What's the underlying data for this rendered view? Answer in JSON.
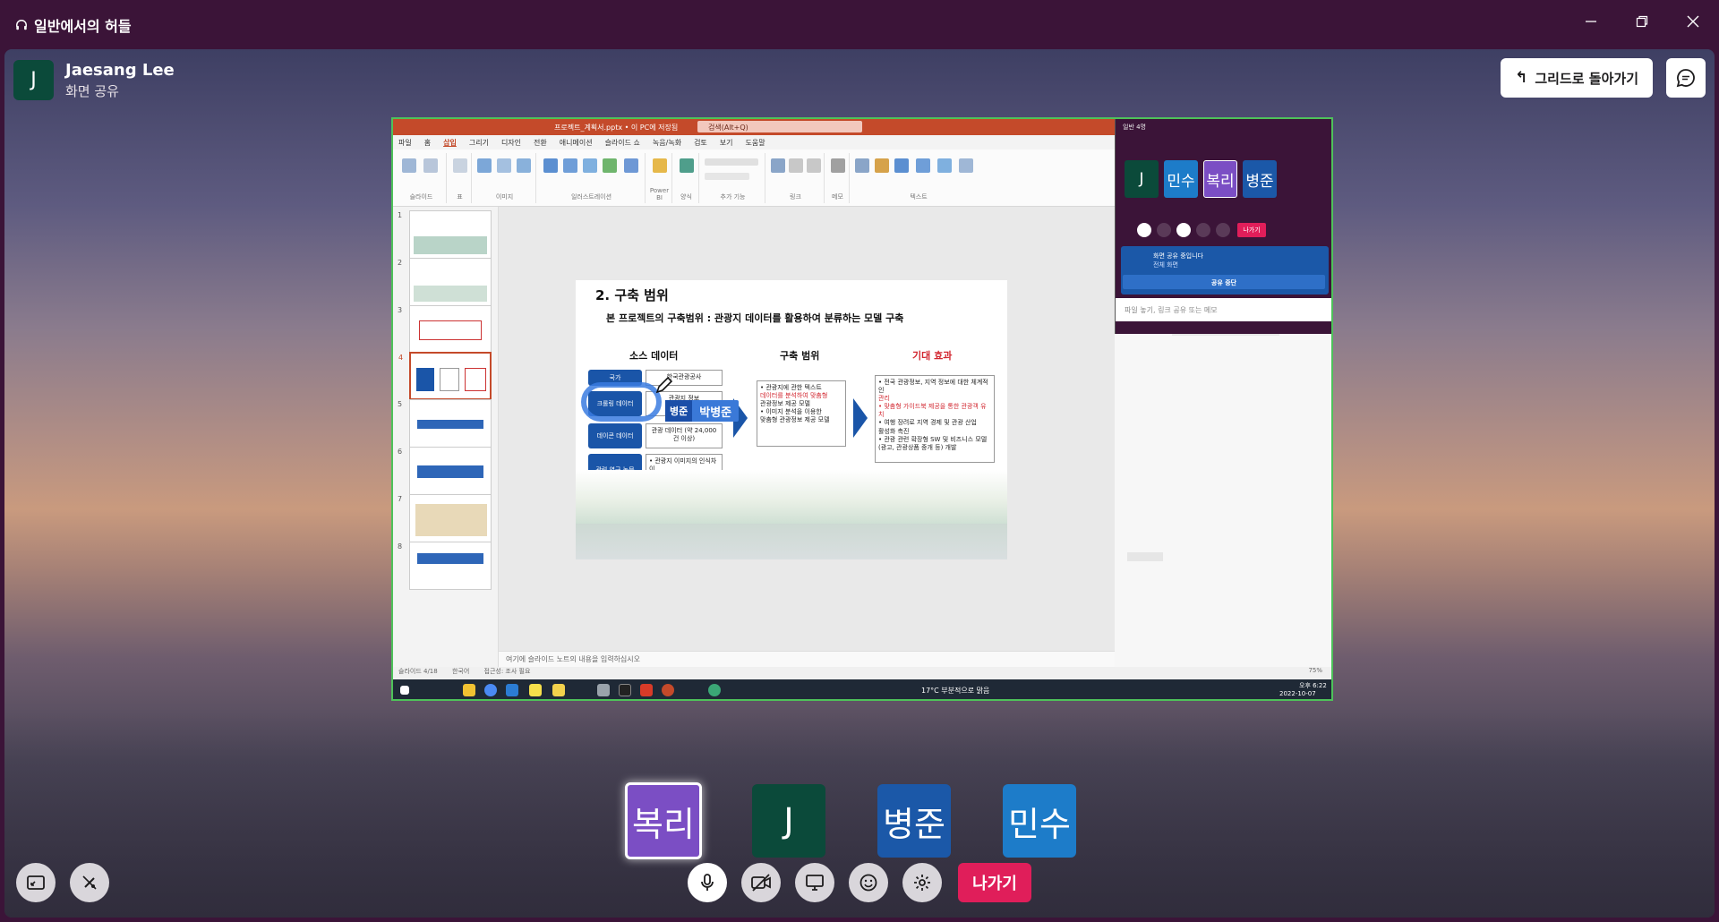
{
  "window": {
    "title": "일반에서의 허들",
    "minimize": "—",
    "restore": "❐",
    "close": "✕"
  },
  "presenter": {
    "initial": "J",
    "name": "Jaesang Lee",
    "status": "화면 공유"
  },
  "buttons": {
    "back_to_grid": "그리드로 돌아가기",
    "leave": "나가기"
  },
  "shared_screen": {
    "file_title": "프로젝트_계획서.pptx • 이 PC에 저장됨",
    "search_placeholder": "검색(Alt+Q)",
    "ribbon_tabs": [
      "파일",
      "홈",
      "삽입",
      "그리기",
      "디자인",
      "전환",
      "애니메이션",
      "슬라이드 쇼",
      "녹음/녹화",
      "검토",
      "보기",
      "도움말"
    ],
    "ribbon_groups": [
      "슬라이드",
      "표",
      "이미지",
      "일러스트레이션",
      "Power BI",
      "양식",
      "추가 기능",
      "링크",
      "메모",
      "텍스트"
    ],
    "slide_numbers": [
      "1",
      "2",
      "3",
      "4",
      "5",
      "6",
      "7",
      "8"
    ],
    "notes_placeholder": "여기에 슬라이드 노트의 내용을 입력하십시오",
    "status_left": "슬라이드 4/18",
    "status_lang": "한국어",
    "status_access": "접근성: 조사 필요",
    "taskbar_weather": "17°C 부분적으로 맑음",
    "taskbar_time": "오후 6:22",
    "taskbar_date": "2022-10-07",
    "zoom": "75%"
  },
  "slide": {
    "title": "2. 구축 범위",
    "subtitle": "본 프로젝트의 구축범위 : 관광지 데이터를 활용하여 분류하는 모델 구축",
    "col_source": "소스 데이터",
    "col_scope": "구축 범위",
    "col_effect": "기대 효과",
    "source_rows": [
      {
        "label": "국가",
        "desc": "한국관광공사"
      },
      {
        "label": "크롤링 데이터",
        "desc": "관광지 정보"
      },
      {
        "label": "데이콘 데이터",
        "desc": "관광 데이터 (약 24,000건 이상)"
      },
      {
        "label": "관련 연구 논문",
        "desc": "• 관광지 이미지의 인식차이\n• 관광단지의 효율적 개발\n방안에 대한 연구 논문 참고"
      }
    ],
    "scope_lines": [
      "• 관광지에 관한 텍스트",
      "데이터를 분석하여 맞춤형",
      "관광정보 제공 모델",
      "• 이미지 분석을 이용한",
      "맞춤형 관광정보 제공 모델"
    ],
    "effect_lines": [
      "• 전국 관광정보, 지역 정보에 대한 체계적인",
      "관리",
      "• 맞춤형 가이드북 제공을 통한 관광객 유치",
      "• 여행 장려로 지역 경제 및 관광 산업",
      "활성화 촉진",
      "• 관광 관련 확장형 SW 및 비즈니스 모델",
      "(광고, 관광상품 중개 등) 개발"
    ],
    "pointer_tag_short": "병준",
    "pointer_tag_full": "박병준"
  },
  "mini_huddle": {
    "title": "일반 4명",
    "tiles": [
      {
        "label": "J",
        "color": "#0b4a3a"
      },
      {
        "label": "민수",
        "color": "#1d7cc9"
      },
      {
        "label": "복리",
        "color": "#7b4ec4"
      },
      {
        "label": "병준",
        "color": "#1b58a8"
      }
    ],
    "leave": "나가기",
    "sharing_text": "화면 공유 중입니다",
    "sharing_sub": "전체 화면",
    "stop_share": "공유 중단",
    "message_placeholder": "파일 놓기, 링크 공유 또는 메모"
  },
  "participants": [
    {
      "label": "복리",
      "color": "#7b4ec4",
      "speaking": true
    },
    {
      "label": "J",
      "color": "#0b4a3a",
      "speaking": false
    },
    {
      "label": "병준",
      "color": "#1b58a8",
      "speaking": false
    },
    {
      "label": "민수",
      "color": "#1d7cc9",
      "speaking": false
    }
  ],
  "controls": [
    "fullscreen-icon",
    "effects-off-icon",
    "microphone-icon",
    "video-off-icon",
    "screen-share-icon",
    "emoji-icon",
    "settings-icon"
  ]
}
